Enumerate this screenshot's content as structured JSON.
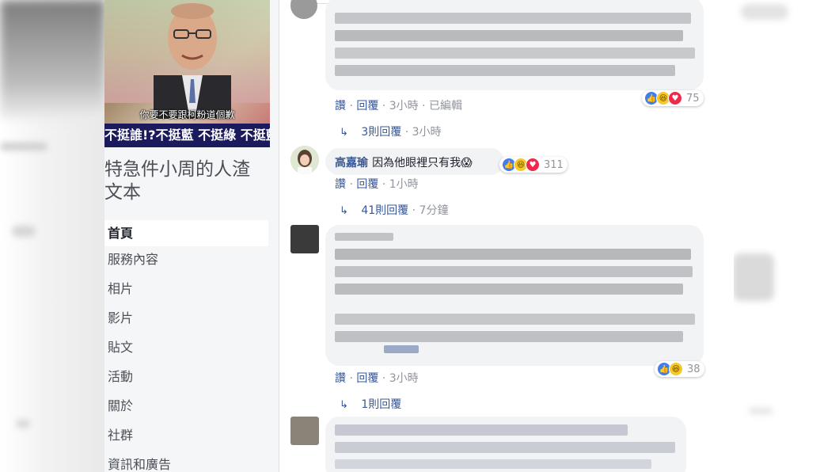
{
  "cover": {
    "subtitle": "你要不要跟柯粉道個歉",
    "ticker": "不挺誰!?不挺藍 不挺綠 不挺藍綠!?"
  },
  "sidebar": {
    "page_name": "特急件小周的人渣文本",
    "nav": [
      {
        "label": "首頁",
        "active": true
      },
      {
        "label": "服務內容"
      },
      {
        "label": "相片"
      },
      {
        "label": "影片"
      },
      {
        "label": "貼文"
      },
      {
        "label": "活動"
      },
      {
        "label": "關於"
      },
      {
        "label": "社群"
      },
      {
        "label": "資訊和廣告"
      }
    ]
  },
  "comments": [
    {
      "blurred": true,
      "actions": {
        "like": "讚",
        "sep": "·",
        "reply": "回覆",
        "time": "3小時",
        "edited": "已編輯"
      },
      "reactions": {
        "icons": [
          "like-icon",
          "haha-icon",
          "love-icon"
        ],
        "count": "75"
      },
      "replies": {
        "label": "3則回覆",
        "time": "3小時"
      }
    },
    {
      "author": "高嘉瑜",
      "text": "因為他眼裡只有我",
      "emoji": "😱",
      "actions": {
        "like": "讚",
        "sep": "·",
        "reply": "回覆",
        "time": "1小時"
      },
      "reactions": {
        "icons": [
          "like-icon",
          "haha-icon",
          "love-icon"
        ],
        "count": "311"
      },
      "replies": {
        "label": "41則回覆",
        "time": "7分鐘"
      }
    },
    {
      "blurred": true,
      "actions": {
        "like": "讚",
        "sep": "·",
        "reply": "回覆",
        "time": "3小時"
      },
      "reactions": {
        "icons": [
          "like-icon",
          "haha-icon"
        ],
        "count": "38"
      },
      "replies": {
        "label": "1則回覆"
      }
    },
    {
      "blurred": true
    }
  ],
  "colors": {
    "link": "#385898",
    "meta": "#90949c",
    "bubble": "#f2f3f5",
    "sidebar_bg": "#f5f6f7",
    "like": "#3f7ef0",
    "haha": "#f7c82c",
    "love": "#f0284a"
  }
}
